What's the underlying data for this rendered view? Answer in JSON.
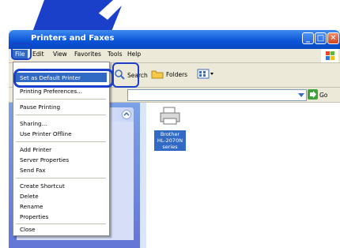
{
  "window": {
    "title": "Printers and Faxes",
    "buttons": {
      "minimize": "_",
      "maximize": "□",
      "close": "✕"
    }
  },
  "menubar": {
    "items": [
      "File",
      "Edit",
      "View",
      "Favorites",
      "Tools",
      "Help"
    ]
  },
  "toolbar": {
    "search_label": "Search",
    "folders_label": "Folders"
  },
  "addressbar": {
    "go_label": "Go"
  },
  "file_menu": {
    "items": [
      "Set as Default Printer",
      "Printing Preferences...",
      "Pause Printing",
      "Sharing...",
      "Use Printer Offline",
      "Add Printer",
      "Server Properties",
      "Send Fax",
      "Create Shortcut",
      "Delete",
      "Rename",
      "Properties",
      "Close"
    ]
  },
  "printer": {
    "label_line1": "Brother",
    "label_line2": "HL-2070N",
    "label_line3": "series"
  },
  "colors": {
    "accent": "#316ac5",
    "callout": "#1a3fc9",
    "titlebar": "#0a52d6"
  }
}
